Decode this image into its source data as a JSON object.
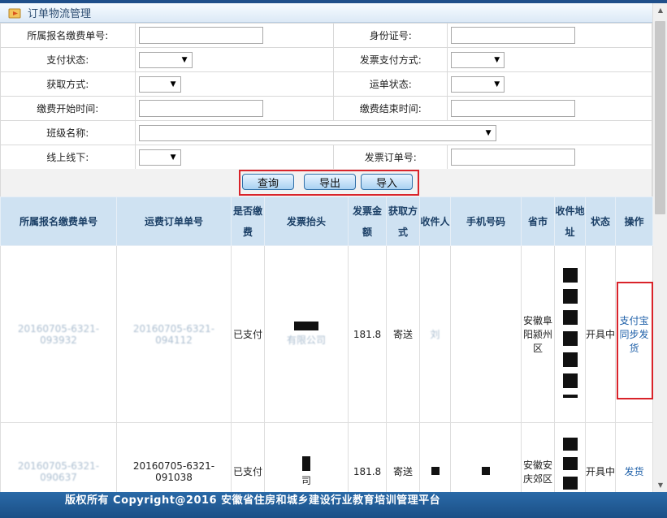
{
  "window": {
    "title": "订单物流管理"
  },
  "form": {
    "rows": [
      {
        "label1": "所属报名缴费单号:",
        "label2": "身份证号:"
      },
      {
        "label1": "支付状态:",
        "label2": "发票支付方式:"
      },
      {
        "label1": "获取方式:",
        "label2": "运单状态:"
      },
      {
        "label1": "缴费开始时间:",
        "label2": "缴费结束时间:"
      },
      {
        "label1": "班级名称:"
      },
      {
        "label1": "线上线下:",
        "label2": "发票订单号:"
      }
    ]
  },
  "buttons": {
    "query": "查询",
    "export": "导出",
    "import": "导入"
  },
  "grid": {
    "headers": [
      "所属报名缴费单号",
      "运费订单单号",
      "是否缴费",
      "发票抬头",
      "发票金额",
      "获取方式",
      "收件人",
      "手机号码",
      "省市",
      "收件地址",
      "状态",
      "操作"
    ],
    "rows": [
      {
        "order_no": "20160705-6321-093932",
        "freight_no": "20160705-6321-094112",
        "paid": "已支付",
        "invoice_title": "有限公司",
        "amount": "181.8",
        "method": "寄送",
        "receiver": "刘",
        "province": "安徽阜阳颍州区",
        "status": "开具中",
        "action": "支付宝同步发货"
      },
      {
        "order_no": "20160705-6321-090637",
        "freight_no": "20160705-6321-091038",
        "paid": "已支付",
        "invoice_title": "司",
        "amount": "181.8",
        "method": "寄送",
        "receiver": "",
        "province": "安徽安庆郊区",
        "status": "开具中",
        "action": "发货"
      }
    ]
  },
  "footer": {
    "text": "版权所有 Copyright@2016 安徽省住房和城乡建设行业教育培训管理平台"
  },
  "colors": {
    "header_bg": "#cfe2f2",
    "footer_bg": "#1b4f86",
    "highlight": "#d9232a",
    "link": "#1d5fa8"
  }
}
